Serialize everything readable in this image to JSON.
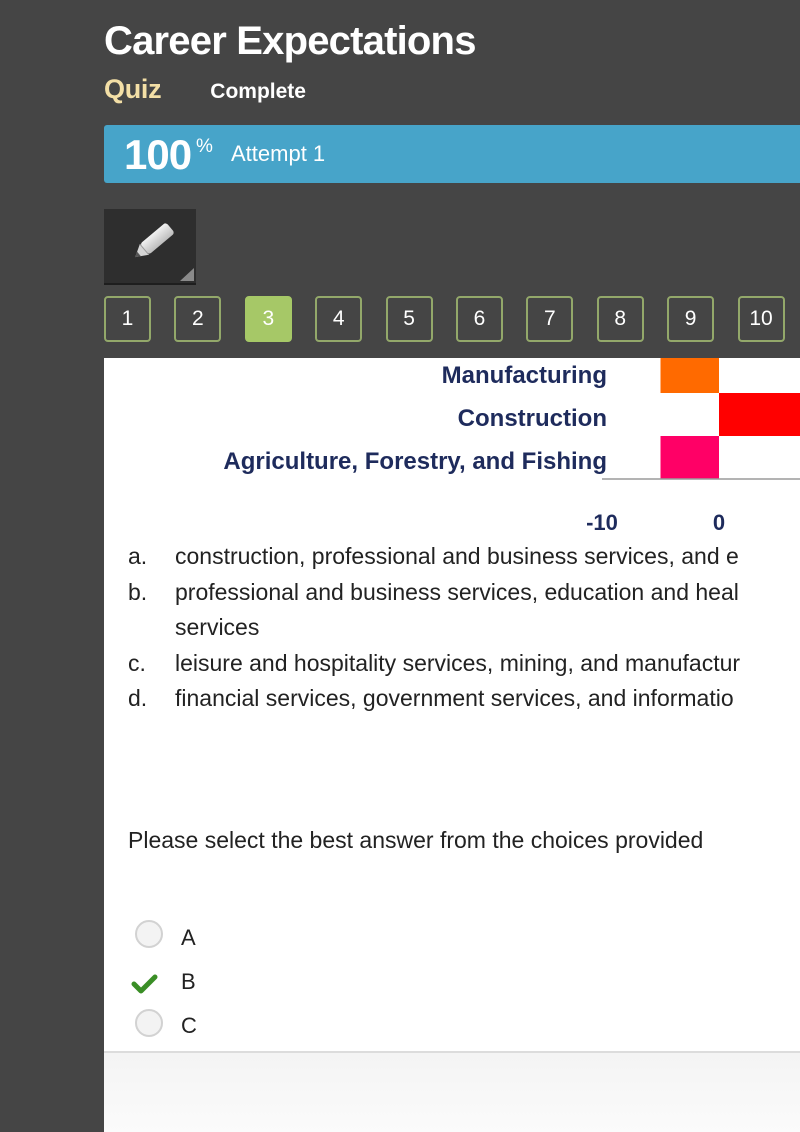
{
  "header": {
    "title": "Career Expectations",
    "section": "Quiz",
    "status": "Complete"
  },
  "score": {
    "percent": "100",
    "percent_sign": "%",
    "attempt": "Attempt 1"
  },
  "toolbar": {
    "pencil_icon": "pencil-icon"
  },
  "question_nav": {
    "items": [
      {
        "label": "1",
        "state": "default"
      },
      {
        "label": "2",
        "state": "default"
      },
      {
        "label": "3",
        "state": "current"
      },
      {
        "label": "4",
        "state": "default"
      },
      {
        "label": "5",
        "state": "default"
      },
      {
        "label": "6",
        "state": "default"
      },
      {
        "label": "7",
        "state": "default"
      },
      {
        "label": "8",
        "state": "default"
      },
      {
        "label": "9",
        "state": "default"
      },
      {
        "label": "10",
        "state": "default"
      }
    ]
  },
  "chart_data": {
    "type": "bar",
    "orientation": "horizontal",
    "categories": [
      "Manufacturing",
      "Construction",
      "Agriculture, Forestry, and Fishing"
    ],
    "values": [
      -5,
      8,
      -5
    ],
    "colors": [
      "#ff6a00",
      "#ff0000",
      "#ff0066"
    ],
    "xticks": [
      -10,
      0
    ],
    "xtick_labels": [
      "-10",
      "0"
    ],
    "title": "",
    "xlabel": "",
    "ylabel": "",
    "grid": false,
    "note": "chart is cropped; only the bottom three categories and the -10 and 0 ticks are visible"
  },
  "question": {
    "choices": [
      {
        "letter": "a.",
        "lines": [
          "construction, professional and business services, and e"
        ]
      },
      {
        "letter": "b.",
        "lines": [
          "professional and business services, education and heal",
          "services"
        ]
      },
      {
        "letter": "c.",
        "lines": [
          "leisure and hospitality services, mining, and manufactur"
        ]
      },
      {
        "letter": "d.",
        "lines": [
          "financial services, government services, and informatio"
        ]
      }
    ],
    "instruction": "Please select the best answer from the choices provided",
    "options": [
      {
        "label": "A",
        "state": "unselected"
      },
      {
        "label": "B",
        "state": "selected-correct"
      },
      {
        "label": "C",
        "state": "unselected"
      }
    ]
  },
  "colors": {
    "background": "#454545",
    "banner": "#47a4c9",
    "quiz_label": "#f3dfa6",
    "nav_border": "#93a86a",
    "nav_current": "#a6c867",
    "check": "#3a8e26"
  }
}
